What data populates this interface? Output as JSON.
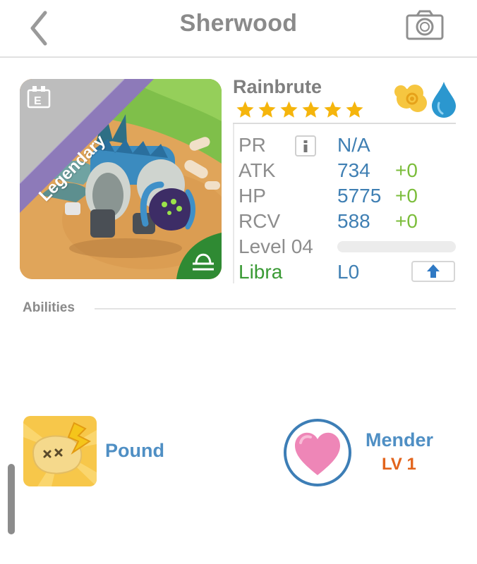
{
  "header": {
    "title": "Sherwood",
    "back_icon": "chevron-left-icon",
    "camera_icon": "camera-icon"
  },
  "monster": {
    "rarity": "Legendary",
    "name": "Rainbrute",
    "stars": 6,
    "elements": [
      "nature-element-icon",
      "water-element-icon"
    ]
  },
  "stats": {
    "pr": {
      "label": "PR",
      "value": "N/A"
    },
    "atk": {
      "label": "ATK",
      "value": "734",
      "bonus": "+0"
    },
    "hp": {
      "label": "HP",
      "value": "5775",
      "bonus": "+0"
    },
    "rcv": {
      "label": "RCV",
      "value": "588",
      "bonus": "+0"
    },
    "level": {
      "label": "Level 04",
      "progress": 0
    },
    "sign": {
      "label": "Libra",
      "value": "L0"
    }
  },
  "abilities": {
    "heading": "Abilities",
    "items": [
      {
        "name": "Pound",
        "icon": "pound-ability-icon"
      },
      {
        "name": "Mender",
        "level": "LV 1",
        "icon": "heart-icon"
      }
    ]
  },
  "colors": {
    "accent_blue": "#3f7fb3",
    "bonus_green": "#7bbd3b",
    "sign_green": "#3a9a35",
    "level_orange": "#e2641c",
    "star_gold": "#f5b50c"
  }
}
